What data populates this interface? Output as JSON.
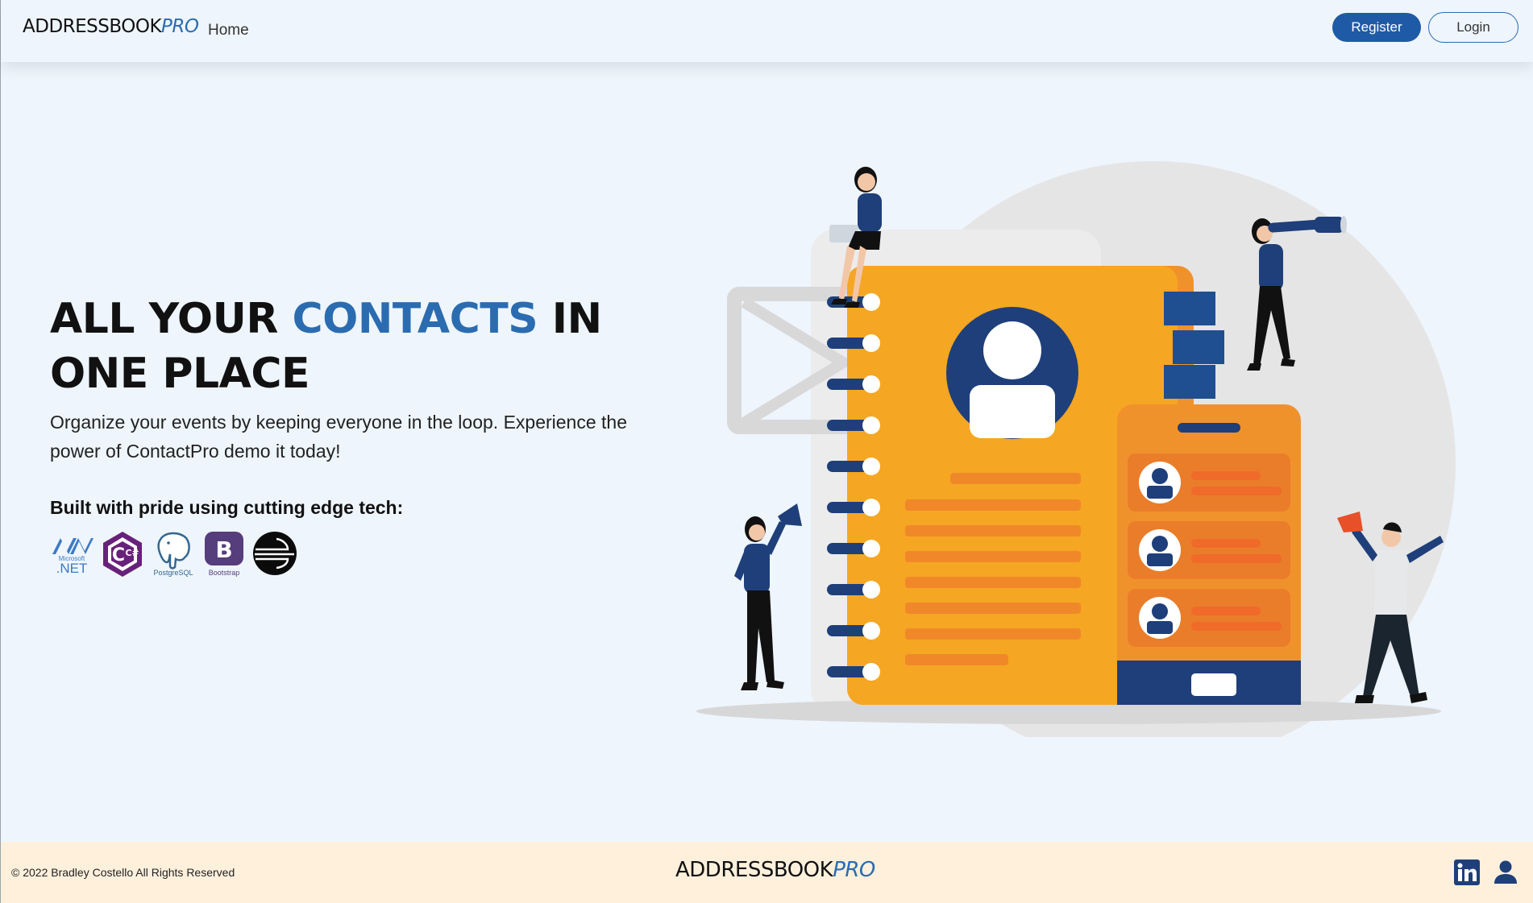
{
  "navbar": {
    "brand_main": "ADDRESSBOOK",
    "brand_accent": "PRO",
    "home_label": "Home",
    "register_label": "Register",
    "login_label": "Login"
  },
  "hero": {
    "title_pre": "ALL YOUR ",
    "title_accent": "CONTACTS",
    "title_post": " IN ONE PLACE",
    "subtitle": "Organize your events by keeping everyone in the loop. Experience the power of ContactPro demo it today!",
    "built_with": "Built with pride using cutting edge tech:"
  },
  "tech_logos": [
    {
      "icon": "dotnet-icon",
      "text_small": "Microsoft",
      "text": ".NET",
      "color": "#3c7ac4"
    },
    {
      "icon": "csharp-icon",
      "text": "C#",
      "color": "#68217a"
    },
    {
      "icon": "postgresql-icon",
      "text": "PostgreSQL",
      "color": "#336791"
    },
    {
      "icon": "bootstrap-icon",
      "text_letter": "B",
      "text": "Bootstrap",
      "color": "#563d7c"
    },
    {
      "icon": "railway-icon",
      "color": "#000000"
    }
  ],
  "illustration": {
    "icon": "address-book-illustration"
  },
  "footer": {
    "copyright": "© 2022 Bradley Costello All Rights Reserved",
    "brand_main": "ADDRESSBOOK",
    "brand_accent": "PRO",
    "linkedin_icon": "linkedin-icon",
    "user_icon": "user-icon"
  },
  "colors": {
    "accent": "#2b6cb0",
    "register_bg": "#1f5aa6",
    "page_bg": "#eef5fc",
    "footer_bg": "#fff0dc",
    "orange": "#f5a623",
    "navy": "#1f3f7a"
  }
}
